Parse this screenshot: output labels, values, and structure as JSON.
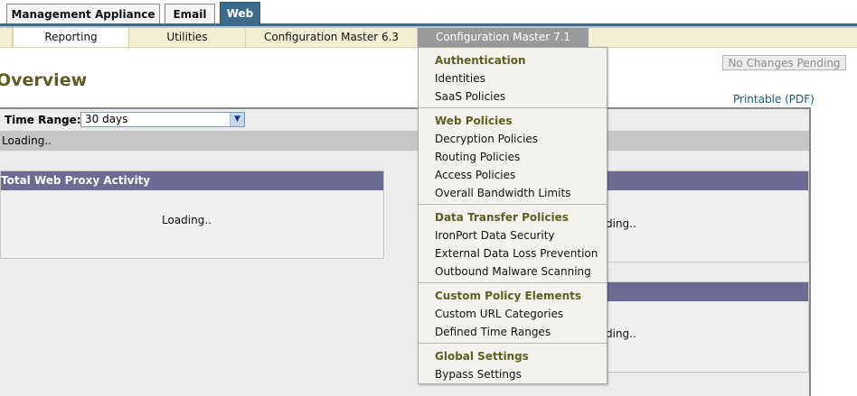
{
  "product_tabs": [
    {
      "label": "Management Appliance"
    },
    {
      "label": "Email"
    },
    {
      "label": "Web"
    }
  ],
  "subnav": [
    {
      "label": "Reporting"
    },
    {
      "label": "Utilities"
    },
    {
      "label": "Configuration Master 6.3"
    },
    {
      "label": "Configuration Master 7.1"
    }
  ],
  "page": {
    "title": "Overview",
    "pending_button": "No Changes Pending",
    "printable": "Printable (PDF)",
    "time_range_label": "Time Range:",
    "time_range_value": "30 days",
    "loading_text": "Loading..",
    "panel_title": "Total Web Proxy Activity",
    "panel_loading": "Loading..",
    "partial_loading_1": "ding..",
    "partial_loading_2": "ding.."
  },
  "dropdown": {
    "sections": [
      {
        "title": "Authentication",
        "items": [
          "Identities",
          "SaaS Policies"
        ]
      },
      {
        "title": "Web Policies",
        "items": [
          "Decryption Policies",
          "Routing Policies",
          "Access Policies",
          "Overall Bandwidth Limits"
        ]
      },
      {
        "title": "Data Transfer Policies",
        "items": [
          "IronPort Data Security",
          "External Data Loss Prevention",
          "Outbound Malware Scanning"
        ]
      },
      {
        "title": "Custom Policy Elements",
        "items": [
          "Custom URL Categories",
          "Defined Time Ranges"
        ]
      },
      {
        "title": "Global Settings",
        "items": [
          "Bypass Settings"
        ]
      }
    ]
  },
  "colors": {
    "active_tab": "#3c6a8c",
    "panel_header": "#6b6b93",
    "section_heading": "#5e5e24"
  }
}
